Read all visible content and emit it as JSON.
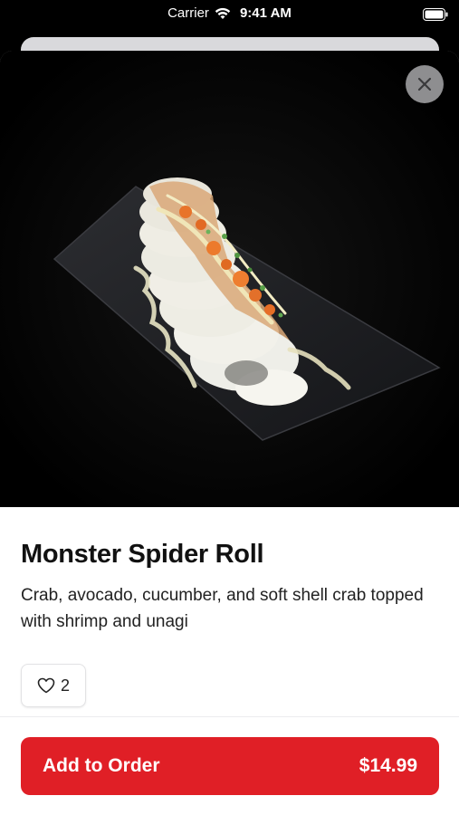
{
  "status_bar": {
    "carrier": "Carrier",
    "time": "9:41 AM",
    "wifi_icon": "wifi-icon",
    "battery_icon": "battery-icon"
  },
  "item": {
    "image": "sushi-roll-photo",
    "close_icon": "close-icon",
    "name": "Monster Spider Roll",
    "description": "Crab, avocado, cucumber, and soft shell crab topped with shrimp and unagi",
    "likes": "2",
    "like_icon": "heart-icon"
  },
  "footer": {
    "add_label": "Add to Order",
    "price": "$14.99"
  },
  "colors": {
    "accent": "#e01f26",
    "background": "#000000",
    "sheet": "#ffffff"
  }
}
